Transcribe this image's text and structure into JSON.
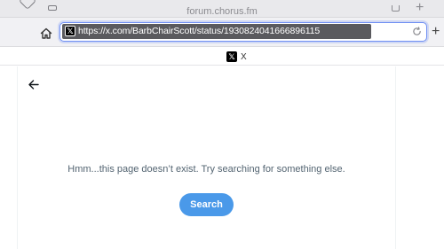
{
  "browser": {
    "tab_title_top": "forum.chorus.fm",
    "url": "https://x.com/BarbChairScott/status/1930824041666896115",
    "favicon_glyph": "𝕏",
    "active_tab": {
      "label": "X",
      "favicon_glyph": "𝕏"
    },
    "new_tab_glyph": "+",
    "colors": {
      "selection": "#5a5a5e",
      "focus_ring": "#6f8ff3"
    }
  },
  "page": {
    "error_message": "Hmm...this page doesn’t exist. Try searching for something else.",
    "search_button_label": "Search",
    "colors": {
      "accent": "#4a99e9",
      "muted_text": "#536471"
    }
  }
}
